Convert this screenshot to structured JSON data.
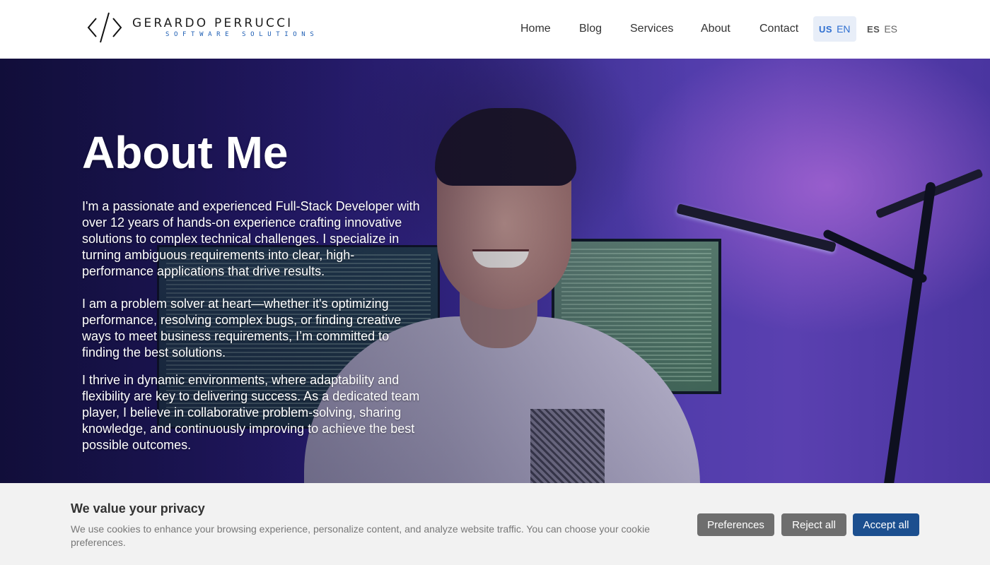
{
  "brand": {
    "name": "GERARDO PERRUCCI",
    "tagline": "SOFTWARE SOLUTIONS",
    "logo_icon": "code-brackets-icon"
  },
  "nav": {
    "items": [
      {
        "label": "Home"
      },
      {
        "label": "Blog"
      },
      {
        "label": "Services"
      },
      {
        "label": "About"
      },
      {
        "label": "Contact"
      }
    ],
    "languages": [
      {
        "flag": "US",
        "code": "EN",
        "active": true
      },
      {
        "flag": "ES",
        "code": "ES",
        "active": false
      }
    ]
  },
  "hero": {
    "title": "About Me",
    "paragraphs": [
      "I'm a passionate and experienced Full-Stack Developer with over 12 years of hands-on experience crafting innovative solutions to complex technical challenges. I specialize in turning ambiguous requirements into clear, high-performance applications that drive results.",
      "I am a problem solver at heart—whether it's optimizing performance, resolving complex bugs, or finding creative ways to meet business requirements, I’m committed to finding the best solutions.",
      "I thrive in dynamic environments, where adaptability and flexibility are key to delivering success. As a dedicated team player, I believe in collaborative problem-solving, sharing knowledge, and continuously improving to achieve the best possible outcomes."
    ]
  },
  "cookie": {
    "title": "We value your privacy",
    "text": "We use cookies to enhance your browsing experience, personalize content, and analyze website traffic. You can choose your cookie preferences.",
    "preferences_label": "Preferences",
    "reject_label": "Reject all",
    "accept_label": "Accept all"
  },
  "colors": {
    "accent": "#1f5fb4",
    "accept_button": "#1c4f8f",
    "secondary_button": "#6e6e6e",
    "active_lang_bg": "#e8eef8",
    "banner_bg": "#f2f2f2"
  }
}
